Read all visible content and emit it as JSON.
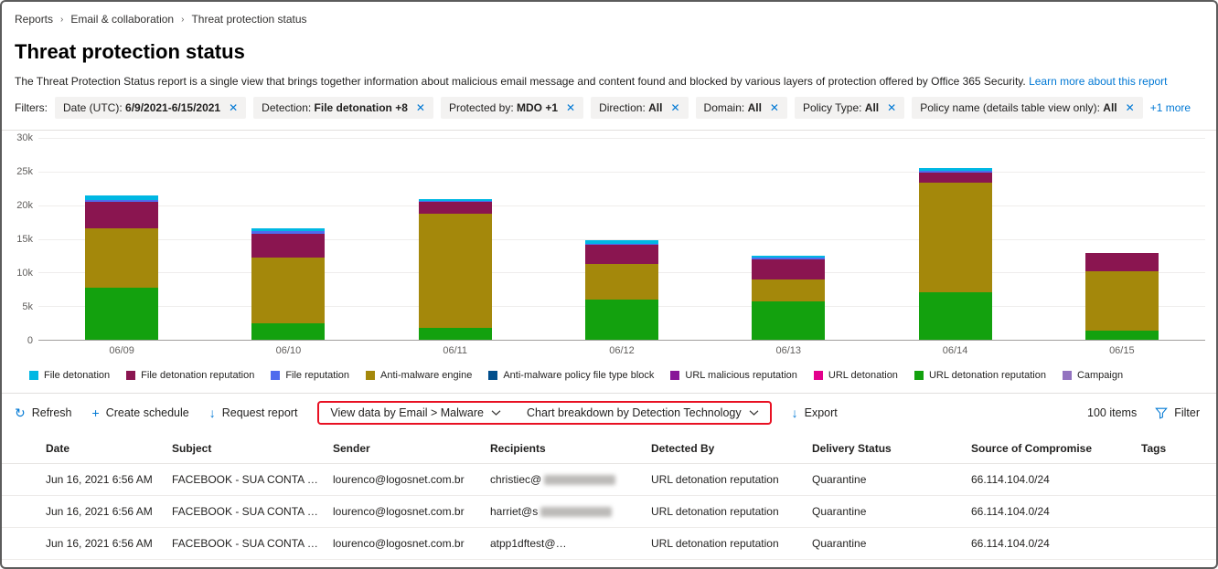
{
  "breadcrumb": {
    "items": [
      "Reports",
      "Email & collaboration",
      "Threat protection status"
    ]
  },
  "page": {
    "title": "Threat protection status",
    "description": "The Threat Protection Status report is a single view that brings together information about malicious email message and content found and blocked by various layers of protection offered by Office 365 Security.",
    "learn_more": "Learn more about this report"
  },
  "filters": {
    "label": "Filters:",
    "chips": [
      {
        "name": "Date (UTC):",
        "value": "6/9/2021-6/15/2021"
      },
      {
        "name": "Detection:",
        "value": "File detonation +8"
      },
      {
        "name": "Protected by:",
        "value": "MDO +1"
      },
      {
        "name": "Direction:",
        "value": "All"
      },
      {
        "name": "Domain:",
        "value": "All"
      },
      {
        "name": "Policy Type:",
        "value": "All"
      },
      {
        "name": "Policy name (details table view only):",
        "value": "All"
      }
    ],
    "more_link": "+1 more"
  },
  "chart_data": {
    "type": "bar",
    "stacked": true,
    "title": "",
    "categories": [
      "06/09",
      "06/10",
      "06/11",
      "06/12",
      "06/13",
      "06/14",
      "06/15"
    ],
    "series": [
      {
        "name": "URL detonation reputation",
        "color": "#13a10e",
        "values": [
          7800,
          2500,
          1800,
          6000,
          5700,
          7000,
          1300
        ]
      },
      {
        "name": "Anti-malware engine",
        "color": "#a4880b",
        "values": [
          8700,
          9700,
          16900,
          5300,
          3300,
          16300,
          8900
        ]
      },
      {
        "name": "File detonation reputation",
        "color": "#8a1550",
        "values": [
          4000,
          3600,
          1800,
          2800,
          3000,
          1500,
          2700
        ]
      },
      {
        "name": "File reputation",
        "color": "#4f6bed",
        "values": [
          300,
          300,
          150,
          200,
          200,
          300,
          0
        ]
      },
      {
        "name": "File detonation",
        "color": "#00b7e3",
        "values": [
          700,
          400,
          250,
          500,
          300,
          400,
          0
        ]
      }
    ],
    "ylim": [
      0,
      30000
    ],
    "yticks": [
      "30k",
      "25k",
      "20k",
      "15k",
      "10k",
      "5k",
      "0"
    ],
    "xlabel": "",
    "ylabel": "",
    "legend_position": "bottom",
    "grid": true
  },
  "legend": {
    "items": [
      {
        "label": "File detonation",
        "color": "#00b7e3"
      },
      {
        "label": "File detonation reputation",
        "color": "#8a1550"
      },
      {
        "label": "File reputation",
        "color": "#4f6bed"
      },
      {
        "label": "Anti-malware engine",
        "color": "#a4880b"
      },
      {
        "label": "Anti-malware policy file type block",
        "color": "#004e8c"
      },
      {
        "label": "URL malicious reputation",
        "color": "#881798"
      },
      {
        "label": "URL detonation",
        "color": "#e3008c"
      },
      {
        "label": "URL detonation reputation",
        "color": "#13a10e"
      },
      {
        "label": "Campaign",
        "color": "#9373c0"
      }
    ]
  },
  "toolbar": {
    "refresh_label": "Refresh",
    "create_schedule_label": "Create schedule",
    "request_report_label": "Request report",
    "view_data_by_label": "View data by Email > Malware",
    "chart_breakdown_label": "Chart breakdown by Detection Technology",
    "export_label": "Export",
    "items_count": "100 items",
    "filter_label": "Filter"
  },
  "table": {
    "columns": [
      "Date",
      "Subject",
      "Sender",
      "Recipients",
      "Detected By",
      "Delivery Status",
      "Source of Compromise",
      "Tags"
    ],
    "rows": [
      {
        "date": "Jun 16, 2021 6:56 AM",
        "subject": "FACEBOOK - SUA CONTA FOI TEMP...",
        "sender": "lourenco@logosnet.com.br",
        "recipient": "christiec@",
        "recipient_redacted": true,
        "recipient_suffix": "",
        "detected_by": "URL detonation reputation",
        "delivery_status": "Quarantine",
        "source_of_compromise": "66.114.104.0/24",
        "tags": ""
      },
      {
        "date": "Jun 16, 2021 6:56 AM",
        "subject": "FACEBOOK - SUA CONTA FOI TEMP...",
        "sender": "lourenco@logosnet.com.br",
        "recipient": "harriet@s",
        "recipient_redacted": true,
        "recipient_suffix": "",
        "detected_by": "URL detonation reputation",
        "delivery_status": "Quarantine",
        "source_of_compromise": "66.114.104.0/24",
        "tags": ""
      },
      {
        "date": "Jun 16, 2021 6:56 AM",
        "subject": "FACEBOOK - SUA CONTA FOI TEMP...",
        "sender": "lourenco@logosnet.com.br",
        "recipient": "atpp1dftest@",
        "recipient_redacted": true,
        "recipient_suffix": "...",
        "detected_by": "URL detonation reputation",
        "delivery_status": "Quarantine",
        "source_of_compromise": "66.114.104.0/24",
        "tags": ""
      }
    ]
  },
  "colors": {
    "accent": "#0078d4",
    "highlight_box": "#e81123",
    "chip_background": "#f3f2f1"
  }
}
